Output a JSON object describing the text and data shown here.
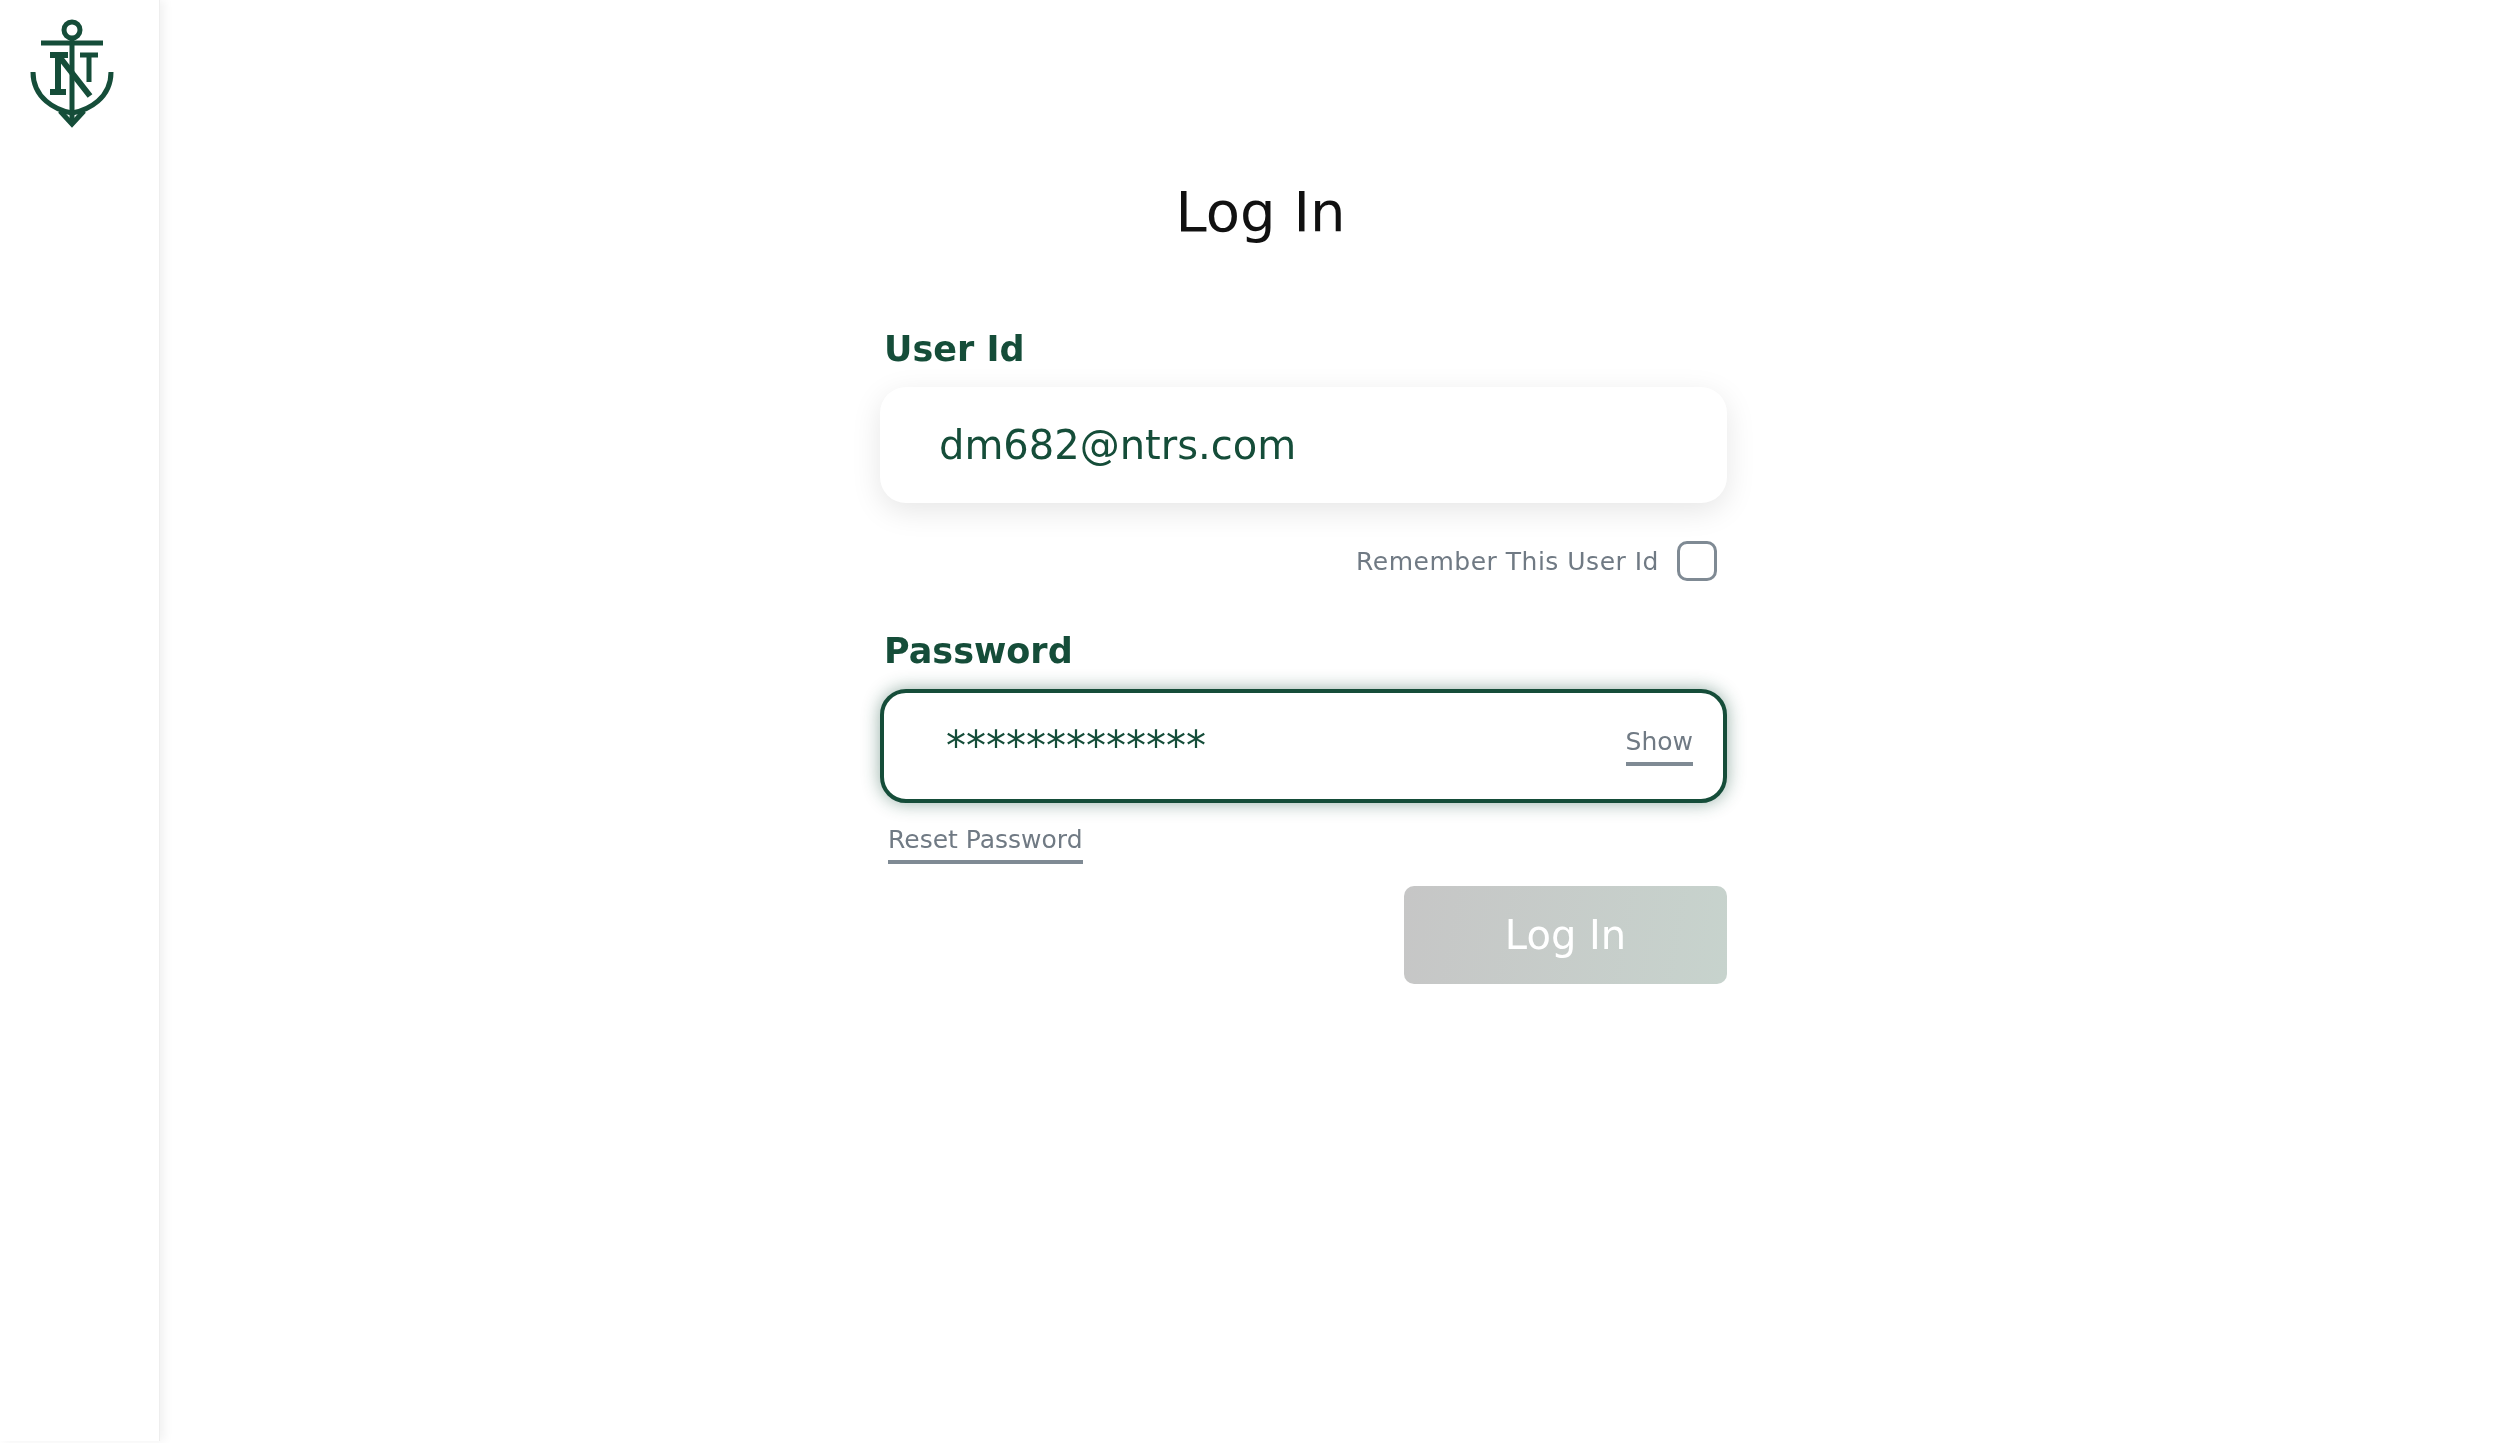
{
  "title": "Log In",
  "user_id": {
    "label": "User Id",
    "value": "dm682@ntrs.com"
  },
  "remember": {
    "label": "Remember This User Id",
    "checked": false
  },
  "password": {
    "label": "Password",
    "value": "*************",
    "focused": true,
    "toggle": "Show"
  },
  "reset_link": "Reset Password",
  "login_button": {
    "label": "Log In",
    "disabled": true
  }
}
